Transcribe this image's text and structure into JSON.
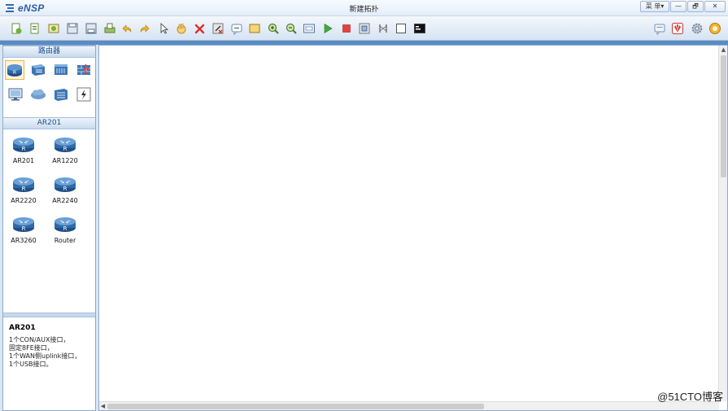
{
  "app": {
    "name": "eNSP",
    "window_title": "新建拓扑",
    "menu_button": "菜 单▾",
    "minimize": "—",
    "restore": "🗗",
    "close": "✕"
  },
  "toolbar": {
    "left_icons": [
      "new-topology-icon",
      "new-sample-icon",
      "open-icon",
      "save-icon",
      "save-as-icon",
      "print-icon",
      "undo-icon",
      "redo-icon",
      "select-icon",
      "hand-icon",
      "delete-icon",
      "delete-link-icon",
      "text-icon",
      "rectangle-icon",
      "zoom-in-icon",
      "zoom-out-icon",
      "fit-icon",
      "start-device-icon",
      "stop-device-icon",
      "capture-icon",
      "show-interface-icon",
      "grid-icon",
      "console-icon"
    ],
    "right_icons": [
      "forum-icon",
      "huawei-logo-icon",
      "settings-icon",
      "help-icon"
    ]
  },
  "left_panel": {
    "category_header": "路由器",
    "categories": [
      {
        "name": "router-category-icon",
        "selected": true
      },
      {
        "name": "switch-category-icon",
        "selected": false
      },
      {
        "name": "wireless-category-icon",
        "selected": false
      },
      {
        "name": "firewall-category-icon",
        "selected": false
      },
      {
        "name": "terminal-category-icon",
        "selected": false
      },
      {
        "name": "cloud-category-icon",
        "selected": false
      },
      {
        "name": "other-device-category-icon",
        "selected": false
      },
      {
        "name": "connection-category-icon",
        "selected": false
      }
    ],
    "device_header": "AR201",
    "devices": [
      {
        "label": "AR201"
      },
      {
        "label": "AR1220"
      },
      {
        "label": "AR2220"
      },
      {
        "label": "AR2240"
      },
      {
        "label": "AR3260"
      },
      {
        "label": "Router"
      }
    ],
    "description": {
      "title": "AR201",
      "lines": [
        "1个CON/AUX接口，",
        "固定8FE接口，",
        "1个WAN侧uplink接口，",
        "1个USB接口。"
      ]
    }
  },
  "canvas": {
    "watermark": "@51CTO博客"
  },
  "colors": {
    "accent": "#2a5fa8",
    "panel_border": "#8eaacd",
    "header_text": "#1d4e8c"
  }
}
